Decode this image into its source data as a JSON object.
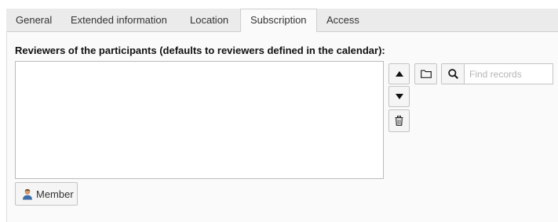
{
  "tabs": [
    {
      "label": "General",
      "active": false
    },
    {
      "label": "Extended information",
      "active": false
    },
    {
      "label": "Location",
      "active": false
    },
    {
      "label": "Subscription",
      "active": true
    },
    {
      "label": "Access",
      "active": false
    }
  ],
  "field": {
    "label": "Reviewers of the participants (defaults to reviewers defined in the calendar):",
    "items": []
  },
  "buttons": {
    "move_up_icon": "triangle-up-icon",
    "move_down_icon": "triangle-down-icon",
    "delete_icon": "trash-icon",
    "browse_icon": "folder-icon",
    "search_icon": "search-icon"
  },
  "search": {
    "placeholder": "Find records",
    "value": ""
  },
  "member_button": {
    "label": "Member",
    "icon": "user-icon"
  }
}
